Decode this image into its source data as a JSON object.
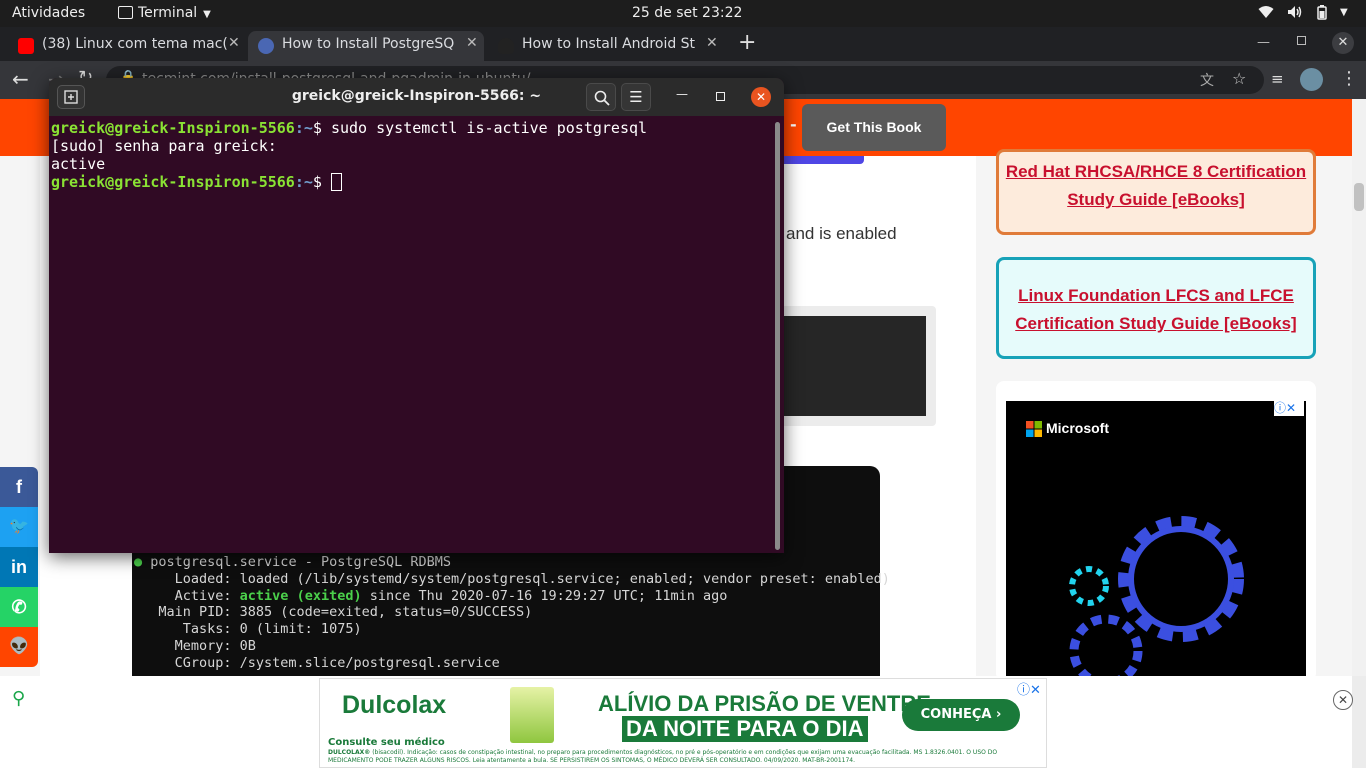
{
  "topbar": {
    "activities": "Atividades",
    "app_menu": "Terminal",
    "clock": "25 de set  23:22"
  },
  "browser": {
    "tabs": [
      {
        "title": "(38) Linux com tema mac(",
        "favicon": "youtube-icon",
        "close": "✕"
      },
      {
        "title": "How to Install PostgreSQ",
        "favicon": "tecmint-icon",
        "close": "✕"
      },
      {
        "title": "How to Install Android Stu",
        "favicon": "tux-icon",
        "close": "✕"
      }
    ],
    "new_tab": "+",
    "url": "tecmint.com/install-postgresql-and-pgadmin-in-ubuntu/"
  },
  "page": {
    "banner_text": "-",
    "get_book_label": "Get This Book",
    "partial_text": "and is enabled",
    "sidebar_boxes": [
      {
        "text": "Red Hat RHCSA/RHCE 8 Certification Study Guide [eBooks]",
        "border": "#e07b39",
        "bg": "#fdebdc"
      },
      {
        "text": "Linux Foundation LFCS and LFCE Certification Study Guide [eBooks]",
        "border": "#17a2b8",
        "bg": "#e6fbfb"
      }
    ],
    "sidebar_ad": {
      "brand": "Microsoft"
    },
    "service_status_lines": [
      {
        "bullet": "●",
        "text": " postgresql.service - PostgreSQL RDBMS"
      },
      {
        "text": "     Loaded: loaded (/lib/systemd/system/postgresql.service; enabled; vendor preset: enabled)"
      },
      {
        "pre": "     Active: ",
        "hl": "active (exited)",
        "post": " since Thu 2020-07-16 19:29:27 UTC; 11min ago"
      },
      {
        "text": "   Main PID: 3885 (code=exited, status=0/SUCCESS)"
      },
      {
        "text": "      Tasks: 0 (limit: 1075)"
      },
      {
        "text": "     Memory: 0B"
      },
      {
        "text": "     CGroup: /system.slice/postgresql.service"
      }
    ]
  },
  "share_buttons": [
    {
      "label": "f",
      "color": "#3b5998",
      "icon": "facebook-icon"
    },
    {
      "label": "🐦",
      "color": "#1da1f2",
      "icon": "twitter-icon"
    },
    {
      "label": "in",
      "color": "#0077b5",
      "icon": "linkedin-icon"
    },
    {
      "label": "✆",
      "color": "#25d366",
      "icon": "whatsapp-icon"
    },
    {
      "label": "👽",
      "color": "#ff4500",
      "icon": "reddit-icon"
    }
  ],
  "bottom_ad": {
    "brand": "Dulcolax",
    "headline_1": "ALÍVIO DA PRISÃO DE VENTRE",
    "headline_2": "DA NOITE PARA O DIA",
    "cta": "CONHEÇA",
    "subtitle": "Consulte seu médico",
    "fine_print_lead": "DULCOLAX®",
    "fine_print": " (bisacodil). Indicação: casos de constipação intestinal, no preparo para procedimentos diagnósticos, no pré e pós-operatório e em condições que exijam uma evacuação facilitada. MS 1.8326.0401. O USO DO MEDICAMENTO PODE TRAZER ALGUNS RISCOS. Leia atentamente a bula. SE PERSISTIREM OS SINTOMAS, O MÉDICO DEVERÁ SER CONSULTADO. 04/09/2020. MAT-BR-2001174."
  },
  "terminal": {
    "title": "greick@greick-Inspiron-5566: ~",
    "user_host": "greick@greick-Inspiron-5566",
    "cwd": ":~",
    "dollar": "$ ",
    "command": "sudo systemctl is-active postgresql",
    "sudo_prompt": "[sudo] senha para greick:",
    "output": "active"
  }
}
